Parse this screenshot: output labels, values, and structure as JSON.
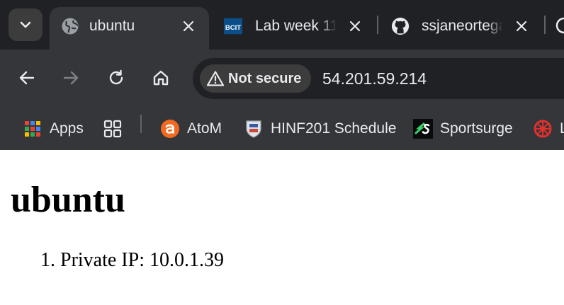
{
  "tabs": [
    {
      "title": "ubuntu",
      "active": true,
      "icon": "globe-icon"
    },
    {
      "title": "Lab week 11",
      "active": false,
      "icon": "bcit-logo"
    },
    {
      "title": "ssjaneortega",
      "active": false,
      "icon": "github-icon"
    }
  ],
  "bcit_logo_text": "BCIT",
  "toolbar": {
    "security_label": "Not secure",
    "url": "54.201.59.214"
  },
  "bookmarks": [
    {
      "label": "Apps",
      "icon": "apps-grid-icon"
    },
    {
      "label": "",
      "icon": "tab-groups-icon"
    },
    {
      "label": "AtoM",
      "icon": "atom-icon"
    },
    {
      "label": "HINF201 Schedule",
      "icon": "crest-icon"
    },
    {
      "label": "Sportsurge",
      "icon": "sportsurge-icon"
    },
    {
      "label": "L",
      "icon": "wheel-icon"
    }
  ],
  "page": {
    "heading": "ubuntu",
    "list_items": [
      "Private IP: 10.0.1.39"
    ]
  }
}
